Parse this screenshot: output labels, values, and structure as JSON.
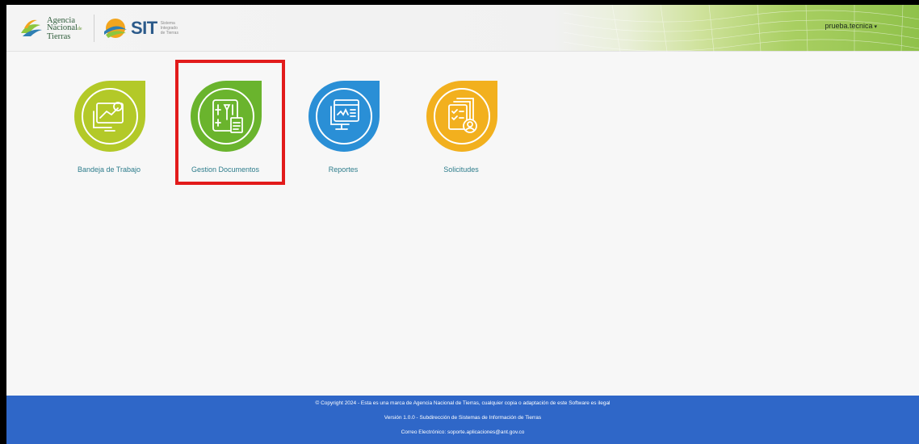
{
  "header": {
    "ant_logo": {
      "line1": "Agencia",
      "line2": "Nacional",
      "line2_suffix": "de",
      "line3": "Tierras"
    },
    "sit_logo": {
      "brand": "SIT",
      "sub1": "Sistema",
      "sub2": "Integrado",
      "sub3": "de Tierras"
    },
    "user": {
      "name": "prueba.tecnica",
      "caret": "▾"
    }
  },
  "tiles": [
    {
      "label": "Bandeja de Trabajo",
      "color": "#b3c928",
      "icon": "chart-board-icon"
    },
    {
      "label": "Gestion Documentos",
      "color": "#6ab42d",
      "icon": "document-management-icon",
      "highlighted": true
    },
    {
      "label": "Reportes",
      "color": "#2a8fd6",
      "icon": "report-monitor-icon"
    },
    {
      "label": "Solicitudes",
      "color": "#f2b01e",
      "icon": "request-checklist-icon"
    }
  ],
  "footer": {
    "copyright": "© Copyright 2024 - Esta es una marca de Agencia Nacional de Tierras, cualquier copia o adaptación de este Software es ilegal",
    "version": "Versión 1.0.0 - Subdirección de Sistemas de Información de Tierras",
    "contact": "Correo Electrónico: soporte.aplicaciones@ant.gov.co"
  },
  "colors": {
    "footer_bg": "#2f67c8",
    "label_text": "#2e7d8c",
    "highlight_border": "#e21b1b"
  }
}
